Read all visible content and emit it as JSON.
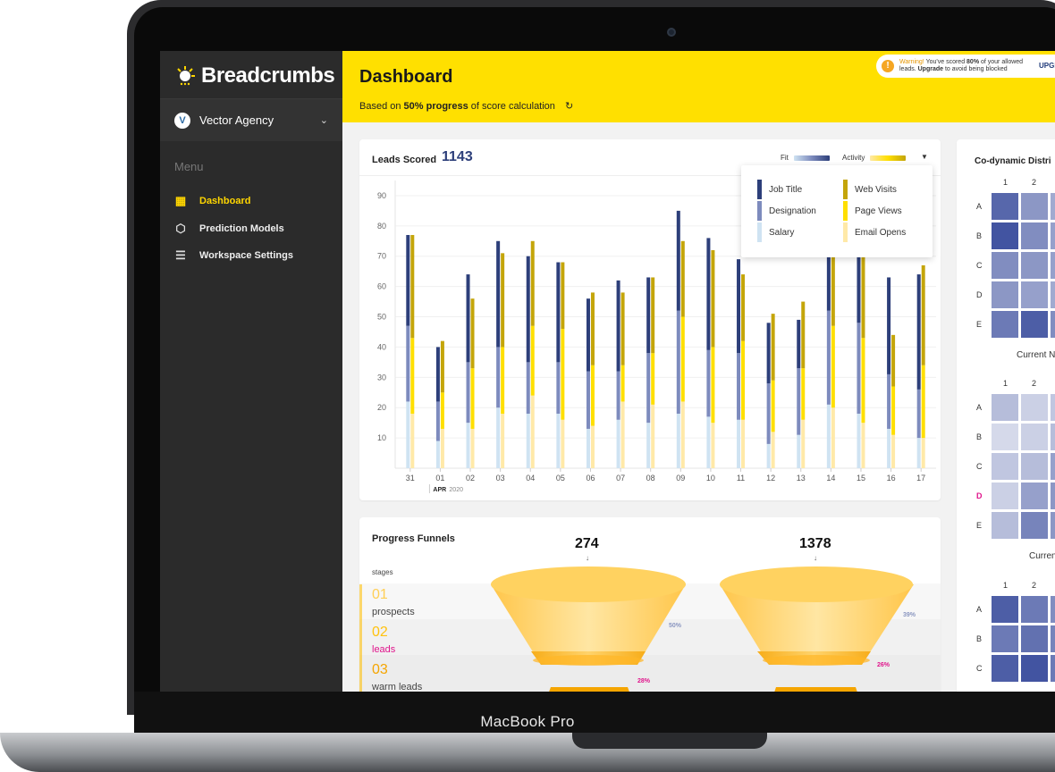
{
  "device_label": "MacBook Pro",
  "sidebar": {
    "brand": "Breadcrumbs",
    "org": "Vector Agency",
    "org_initial": "V",
    "menu_title": "Menu",
    "items": [
      {
        "label": "Dashboard",
        "icon": "grid-icon",
        "active": true
      },
      {
        "label": "Prediction Models",
        "icon": "cube-icon",
        "active": false
      },
      {
        "label": "Workspace Settings",
        "icon": "sliders-icon",
        "active": false
      }
    ]
  },
  "header": {
    "title": "Dashboard",
    "sub_prefix": "Based on ",
    "sub_bold": "50% progress",
    "sub_suffix": " of score calculation",
    "warning_label": "Warning!",
    "warning_text1": " You've scored ",
    "warning_bold": "80%",
    "warning_text2": " of your allowed",
    "warning_line2_a": "leads. ",
    "warning_upgrade": "Upgrade",
    "warning_line2_b": " to avoid being blocked",
    "upgrade_button": "UPGR"
  },
  "leads": {
    "title": "Leads Scored",
    "count": "1143",
    "legend_fit": "Fit",
    "legend_activity": "Activity",
    "dropdown": {
      "fit": [
        "Job Title",
        "Designation",
        "Salary"
      ],
      "activity": [
        "Web Visits",
        "Page Views",
        "Email Opens"
      ]
    }
  },
  "colors": {
    "fit": [
      "#2d3f7a",
      "#7d8bbd",
      "#cfe3f2"
    ],
    "activity": [
      "#c4a50a",
      "#ffdf00",
      "#ffe9a8"
    ],
    "brand_yellow": "#ffe000"
  },
  "chart_data": {
    "type": "bar",
    "categories": [
      "31",
      "01",
      "02",
      "03",
      "04",
      "05",
      "06",
      "07",
      "08",
      "09",
      "10",
      "11",
      "12",
      "13",
      "14",
      "15",
      "16",
      "17"
    ],
    "x_caption_month": "APR",
    "x_caption_year": "2020",
    "ylim": [
      0,
      95
    ],
    "yticks": [
      10,
      20,
      30,
      40,
      50,
      60,
      70,
      80,
      90
    ],
    "series": [
      {
        "name": "Job Title",
        "stack": "Fit",
        "values": [
          30,
          18,
          29,
          35,
          35,
          33,
          24,
          30,
          25,
          33,
          37,
          31,
          20,
          16,
          40,
          40,
          32,
          38
        ]
      },
      {
        "name": "Designation",
        "stack": "Fit",
        "values": [
          25,
          13,
          20,
          20,
          17,
          17,
          19,
          16,
          23,
          34,
          22,
          22,
          20,
          22,
          31,
          30,
          18,
          16
        ]
      },
      {
        "name": "Salary",
        "stack": "Fit",
        "values": [
          22,
          9,
          15,
          20,
          18,
          18,
          13,
          16,
          15,
          18,
          17,
          16,
          8,
          11,
          21,
          18,
          13,
          10
        ]
      },
      {
        "name": "Web Visits",
        "stack": "Activity",
        "values": [
          34,
          17,
          23,
          31,
          28,
          22,
          24,
          24,
          25,
          25,
          32,
          22,
          22,
          22,
          30,
          30,
          17,
          33
        ]
      },
      {
        "name": "Page Views",
        "stack": "Activity",
        "values": [
          25,
          12,
          20,
          22,
          23,
          30,
          20,
          12,
          17,
          28,
          25,
          26,
          17,
          17,
          27,
          28,
          16,
          24
        ]
      },
      {
        "name": "Email Opens",
        "stack": "Activity",
        "values": [
          18,
          13,
          13,
          18,
          24,
          16,
          14,
          22,
          21,
          22,
          15,
          16,
          12,
          16,
          20,
          15,
          11,
          10
        ]
      }
    ]
  },
  "funnels": {
    "title": "Progress Funnels",
    "stages_label": "stages",
    "stages": [
      {
        "num": "01",
        "name": "prospects"
      },
      {
        "num": "02",
        "name": "leads"
      },
      {
        "num": "03",
        "name": "warm leads"
      }
    ],
    "funnel1": {
      "total": "274",
      "pct_a": "50%",
      "pct_b": "28%"
    },
    "funnel2": {
      "total": "1378",
      "pct_a": "39%",
      "pct_b": "26%"
    },
    "arrow": "↓"
  },
  "codynamic": {
    "title": "Co-dynamic Distri",
    "col_labels": [
      "1",
      "2"
    ],
    "row_labels": [
      "A",
      "B",
      "C",
      "D",
      "E"
    ],
    "row_labels_short": [
      "A",
      "B",
      "C"
    ],
    "caption1": "Current N",
    "caption2": "Curren",
    "grid1": [
      [
        0.8,
        0.55,
        0.45
      ],
      [
        0.9,
        0.6,
        0.5
      ],
      [
        0.6,
        0.55,
        0.5
      ],
      [
        0.55,
        0.5,
        0.45
      ],
      [
        0.7,
        0.85,
        0.6
      ]
    ],
    "grid2": [
      [
        0.35,
        0.25,
        0.3
      ],
      [
        0.2,
        0.25,
        0.35
      ],
      [
        0.3,
        0.35,
        0.5
      ],
      [
        0.25,
        0.5,
        0.55
      ],
      [
        0.35,
        0.65,
        0.55
      ]
    ],
    "grid3": [
      [
        0.85,
        0.7,
        0.6
      ],
      [
        0.7,
        0.75,
        0.65
      ],
      [
        0.85,
        0.9,
        0.7
      ],
      [
        0.6,
        0.7,
        0.6
      ]
    ]
  }
}
